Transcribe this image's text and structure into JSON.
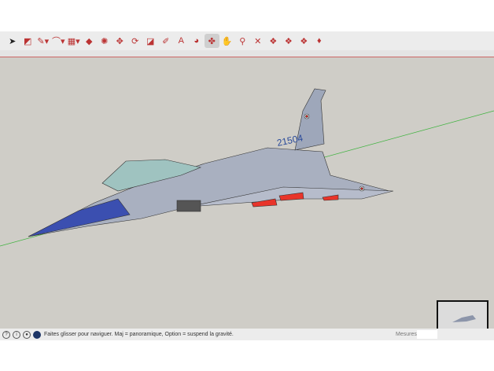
{
  "toolbar": {
    "tools": [
      {
        "name": "select",
        "glyph": "➤"
      },
      {
        "name": "eraser",
        "glyph": "◩"
      },
      {
        "name": "pencil",
        "glyph": "✎▾"
      },
      {
        "name": "arc",
        "glyph": "⌒▾"
      },
      {
        "name": "rectangle",
        "glyph": "▦▾"
      },
      {
        "name": "push-pull",
        "glyph": "◆"
      },
      {
        "name": "follow-me",
        "glyph": "✺"
      },
      {
        "name": "move",
        "glyph": "✥"
      },
      {
        "name": "rotate",
        "glyph": "⟳"
      },
      {
        "name": "scale",
        "glyph": "◪"
      },
      {
        "name": "tape-measure",
        "glyph": "✐"
      },
      {
        "name": "text",
        "glyph": "A"
      },
      {
        "name": "paint-bucket",
        "glyph": "◕"
      },
      {
        "name": "orbit",
        "glyph": "✤"
      },
      {
        "name": "pan",
        "glyph": "✋"
      },
      {
        "name": "zoom",
        "glyph": "⚲"
      },
      {
        "name": "zoom-extents",
        "glyph": "✕"
      },
      {
        "name": "warehouse",
        "glyph": "❖"
      },
      {
        "name": "extension-warehouse",
        "glyph": "❖"
      },
      {
        "name": "send-to-layout",
        "glyph": "❖"
      },
      {
        "name": "ruby",
        "glyph": "♦"
      }
    ],
    "active": "orbit"
  },
  "model": {
    "tail_number": "21504"
  },
  "status": {
    "message": "Faites glisser pour naviguer. Maj = panoramique, Option =  suspend la gravité.",
    "measures_label": "Mesures",
    "measures_value": ""
  },
  "colors": {
    "viewport": "#cfcdc7",
    "aircraft": "#a9b0c0",
    "nose": "#3b4fb0",
    "missiles": "#e8342a"
  }
}
